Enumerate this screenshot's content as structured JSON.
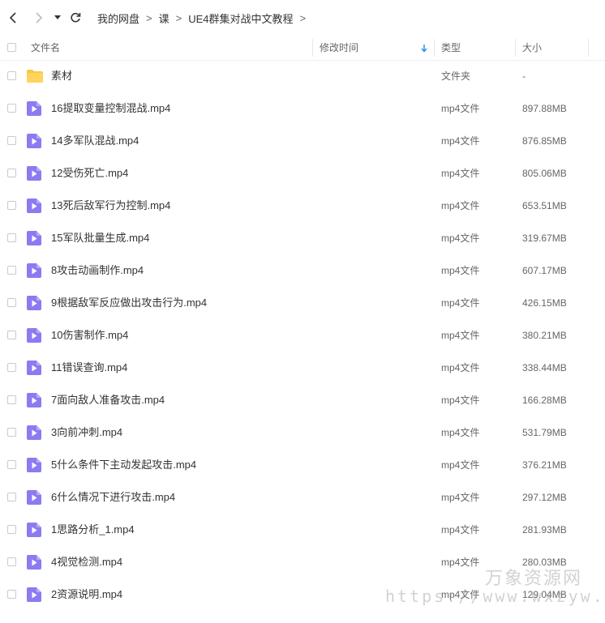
{
  "breadcrumb": [
    "我的网盘",
    "课",
    "UE4群集对战中文教程"
  ],
  "breadcrumb_separator": ">",
  "columns": {
    "name": "文件名",
    "modified": "修改时间",
    "type": "类型",
    "size": "大小"
  },
  "colors": {
    "folder": "#f7c948",
    "video": "#8a7cf0",
    "sort_arrow": "#2b8ff0"
  },
  "files": [
    {
      "name": "素材",
      "type": "文件夹",
      "size": "-",
      "icon": "folder-icon"
    },
    {
      "name": "16提取变量控制混战.mp4",
      "type": "mp4文件",
      "size": "897.88MB",
      "icon": "video-file-icon"
    },
    {
      "name": "14多军队混战.mp4",
      "type": "mp4文件",
      "size": "876.85MB",
      "icon": "video-file-icon"
    },
    {
      "name": "12受伤死亡.mp4",
      "type": "mp4文件",
      "size": "805.06MB",
      "icon": "video-file-icon"
    },
    {
      "name": "13死后敌军行为控制.mp4",
      "type": "mp4文件",
      "size": "653.51MB",
      "icon": "video-file-icon"
    },
    {
      "name": "15军队批量生成.mp4",
      "type": "mp4文件",
      "size": "319.67MB",
      "icon": "video-file-icon"
    },
    {
      "name": "8攻击动画制作.mp4",
      "type": "mp4文件",
      "size": "607.17MB",
      "icon": "video-file-icon"
    },
    {
      "name": "9根据敌军反应做出攻击行为.mp4",
      "type": "mp4文件",
      "size": "426.15MB",
      "icon": "video-file-icon"
    },
    {
      "name": "10伤害制作.mp4",
      "type": "mp4文件",
      "size": "380.21MB",
      "icon": "video-file-icon"
    },
    {
      "name": "11错误查询.mp4",
      "type": "mp4文件",
      "size": "338.44MB",
      "icon": "video-file-icon"
    },
    {
      "name": "7面向敌人准备攻击.mp4",
      "type": "mp4文件",
      "size": "166.28MB",
      "icon": "video-file-icon"
    },
    {
      "name": "3向前冲刺.mp4",
      "type": "mp4文件",
      "size": "531.79MB",
      "icon": "video-file-icon"
    },
    {
      "name": "5什么条件下主动发起攻击.mp4",
      "type": "mp4文件",
      "size": "376.21MB",
      "icon": "video-file-icon"
    },
    {
      "name": "6什么情况下进行攻击.mp4",
      "type": "mp4文件",
      "size": "297.12MB",
      "icon": "video-file-icon"
    },
    {
      "name": "1思路分析_1.mp4",
      "type": "mp4文件",
      "size": "281.93MB",
      "icon": "video-file-icon"
    },
    {
      "name": "4视觉检测.mp4",
      "type": "mp4文件",
      "size": "280.03MB",
      "icon": "video-file-icon"
    },
    {
      "name": "2资源说明.mp4",
      "type": "mp4文件",
      "size": "129.04MB",
      "icon": "video-file-icon"
    }
  ],
  "watermark": {
    "text": "万象资源网",
    "url": "https://www.wxzyw.cn"
  }
}
